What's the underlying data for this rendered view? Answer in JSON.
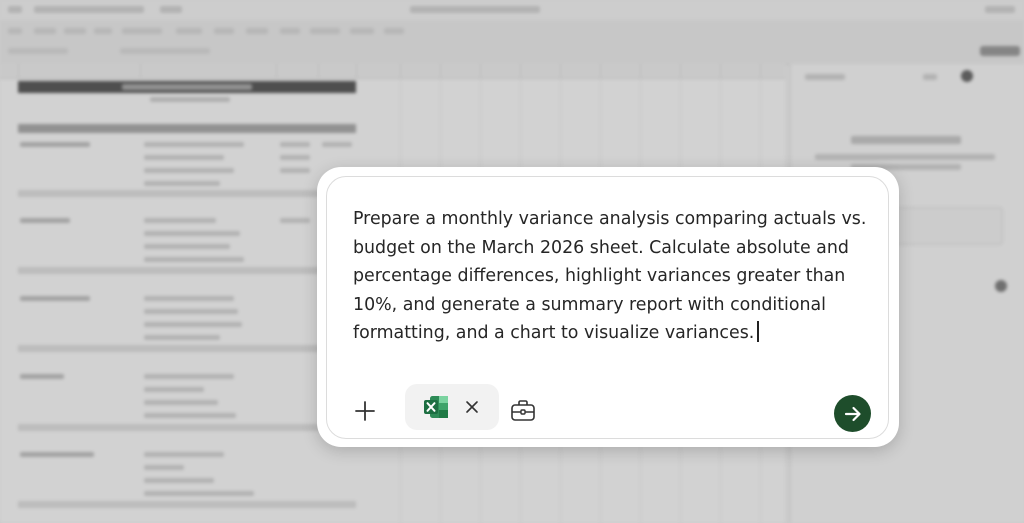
{
  "prompt": {
    "text": "Prepare a monthly variance analysis comparing actuals vs. budget on the March 2026 sheet. Calculate absolute and percentage differences, highlight variances greater than 10%, and generate a summary report with conditional formatting, and a chart to visualize variances."
  },
  "toolbar": {
    "add_icon": "plus-icon",
    "attachment_icon": "excel-icon",
    "remove_icon": "close-icon",
    "tools_icon": "briefcase-icon",
    "send_icon": "arrow-right-icon"
  },
  "colors": {
    "send_button": "#1e4d2b",
    "excel_green": "#1d6f42",
    "chip_bg": "#f2f2f2"
  }
}
